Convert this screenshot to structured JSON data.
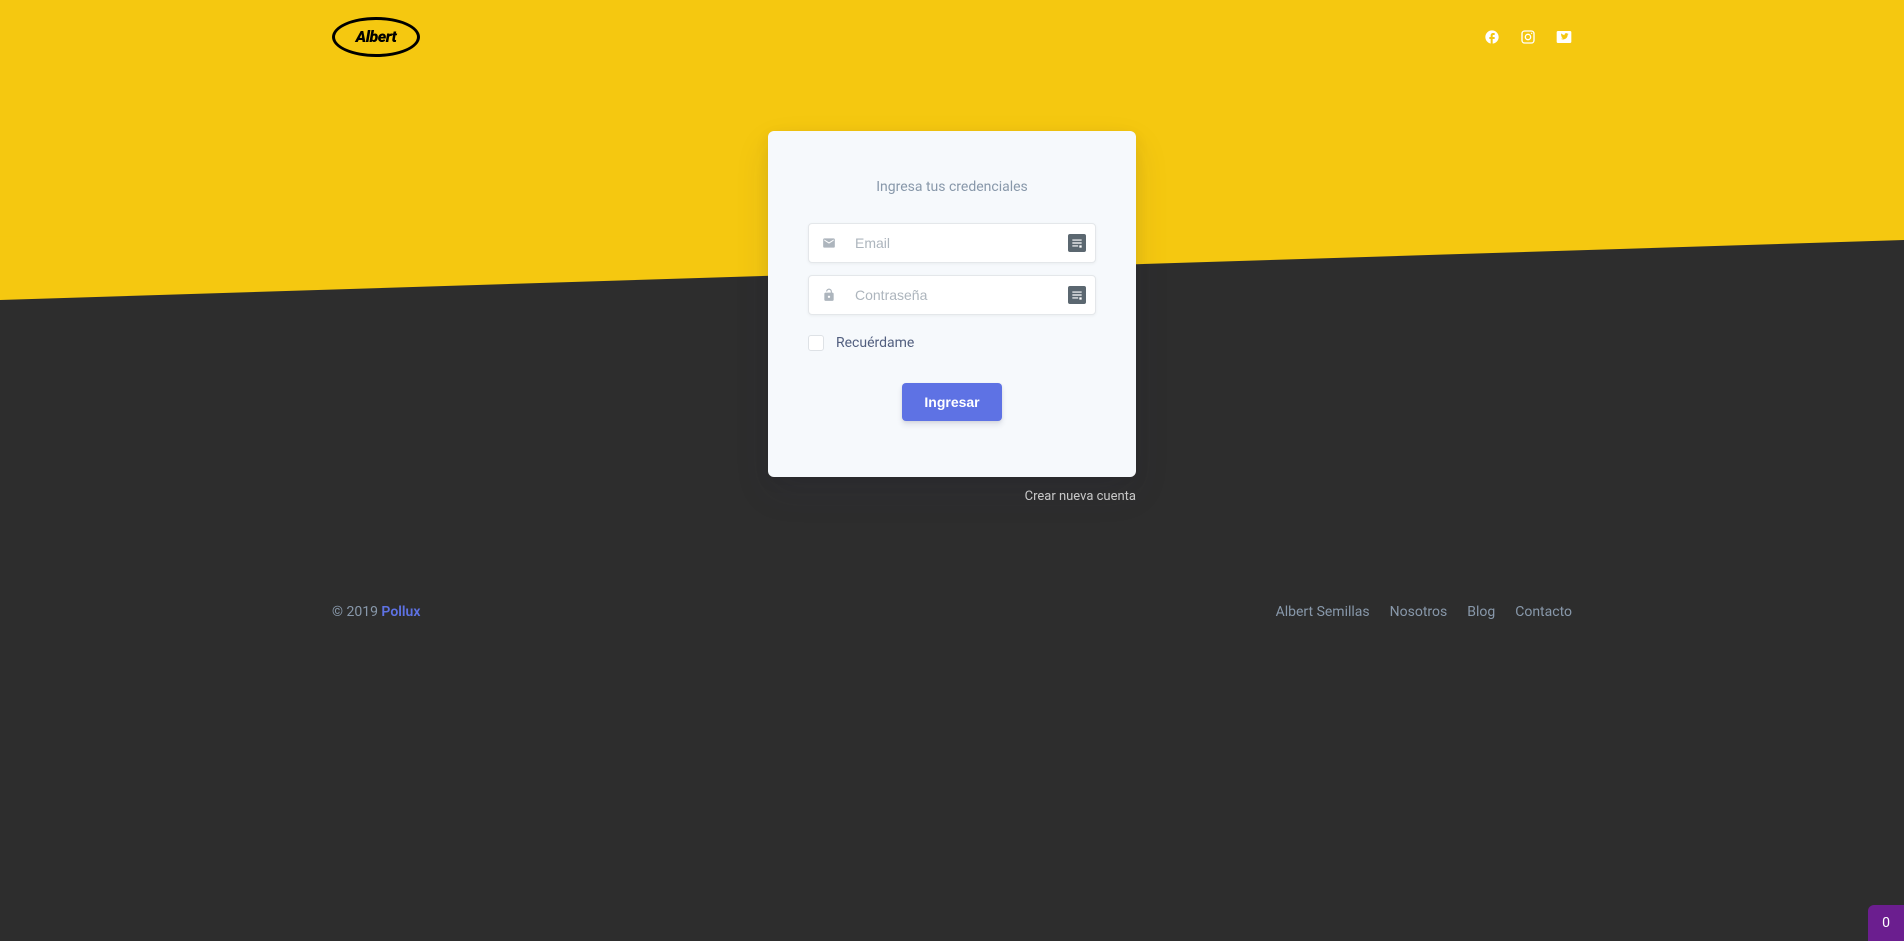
{
  "logo": {
    "text": "Albert"
  },
  "login": {
    "title": "Ingresa tus credenciales",
    "email_placeholder": "Email",
    "password_placeholder": "Contraseña",
    "remember_label": "Recuérdame",
    "submit_label": "Ingresar"
  },
  "links": {
    "create_account": "Crear nueva cuenta"
  },
  "footer": {
    "copyright_prefix": "© 2019 ",
    "brand": "Pollux",
    "nav": [
      "Albert Semillas",
      "Nosotros",
      "Blog",
      "Contacto"
    ]
  },
  "corner_badge": "0"
}
